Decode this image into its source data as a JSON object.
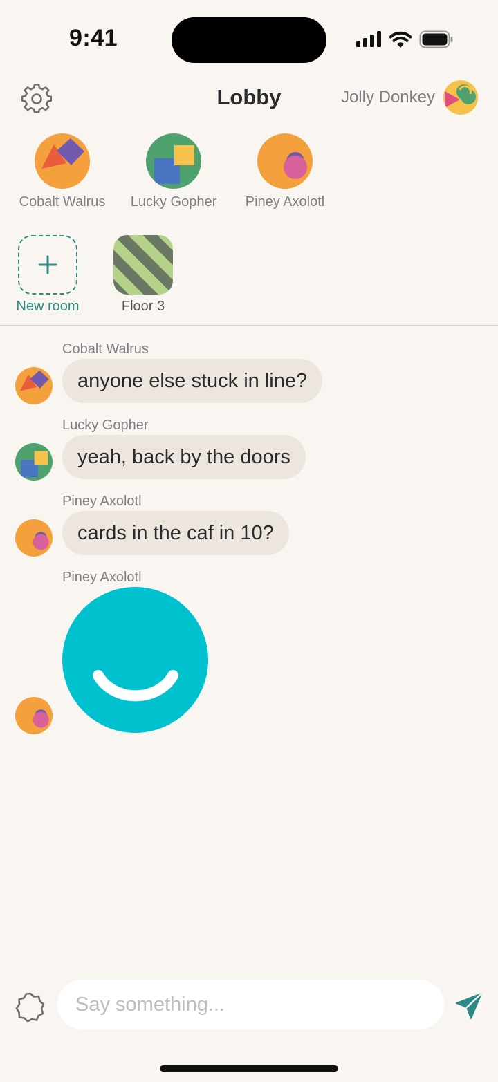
{
  "status_bar": {
    "time": "9:41"
  },
  "header": {
    "title": "Lobby",
    "settings_icon": "gear-icon",
    "user_name": "Jolly Donkey"
  },
  "people": [
    {
      "name": "Cobalt Walrus",
      "avatar_bg": "#F4A03C"
    },
    {
      "name": "Lucky Gopher",
      "avatar_bg": "#4FA26D"
    },
    {
      "name": "Piney Axolotl",
      "avatar_bg": "#F4A03C"
    }
  ],
  "rooms": [
    {
      "name": "New room",
      "icon": "plus-icon"
    },
    {
      "name": "Floor 3",
      "icon": "striped-pattern"
    }
  ],
  "messages": [
    {
      "sender": "Cobalt Walrus",
      "text": "anyone else stuck in line?"
    },
    {
      "sender": "Lucky Gopher",
      "text": "yeah, back by the doors"
    },
    {
      "sender": "Piney Axolotl",
      "text": "cards in the caf in 10?"
    },
    {
      "sender": "Piney Axolotl",
      "sticker": "smiley-sticker",
      "sticker_color": "#00C2CE"
    }
  ],
  "composer": {
    "placeholder": "Say something...",
    "value": "",
    "sticker_icon": "sticker-icon",
    "send_icon": "send-icon"
  },
  "colors": {
    "background": "#F9F6F1",
    "accent": "#2E8A87",
    "bubble": "#ECE6DE",
    "muted_text": "#7E7E84"
  }
}
